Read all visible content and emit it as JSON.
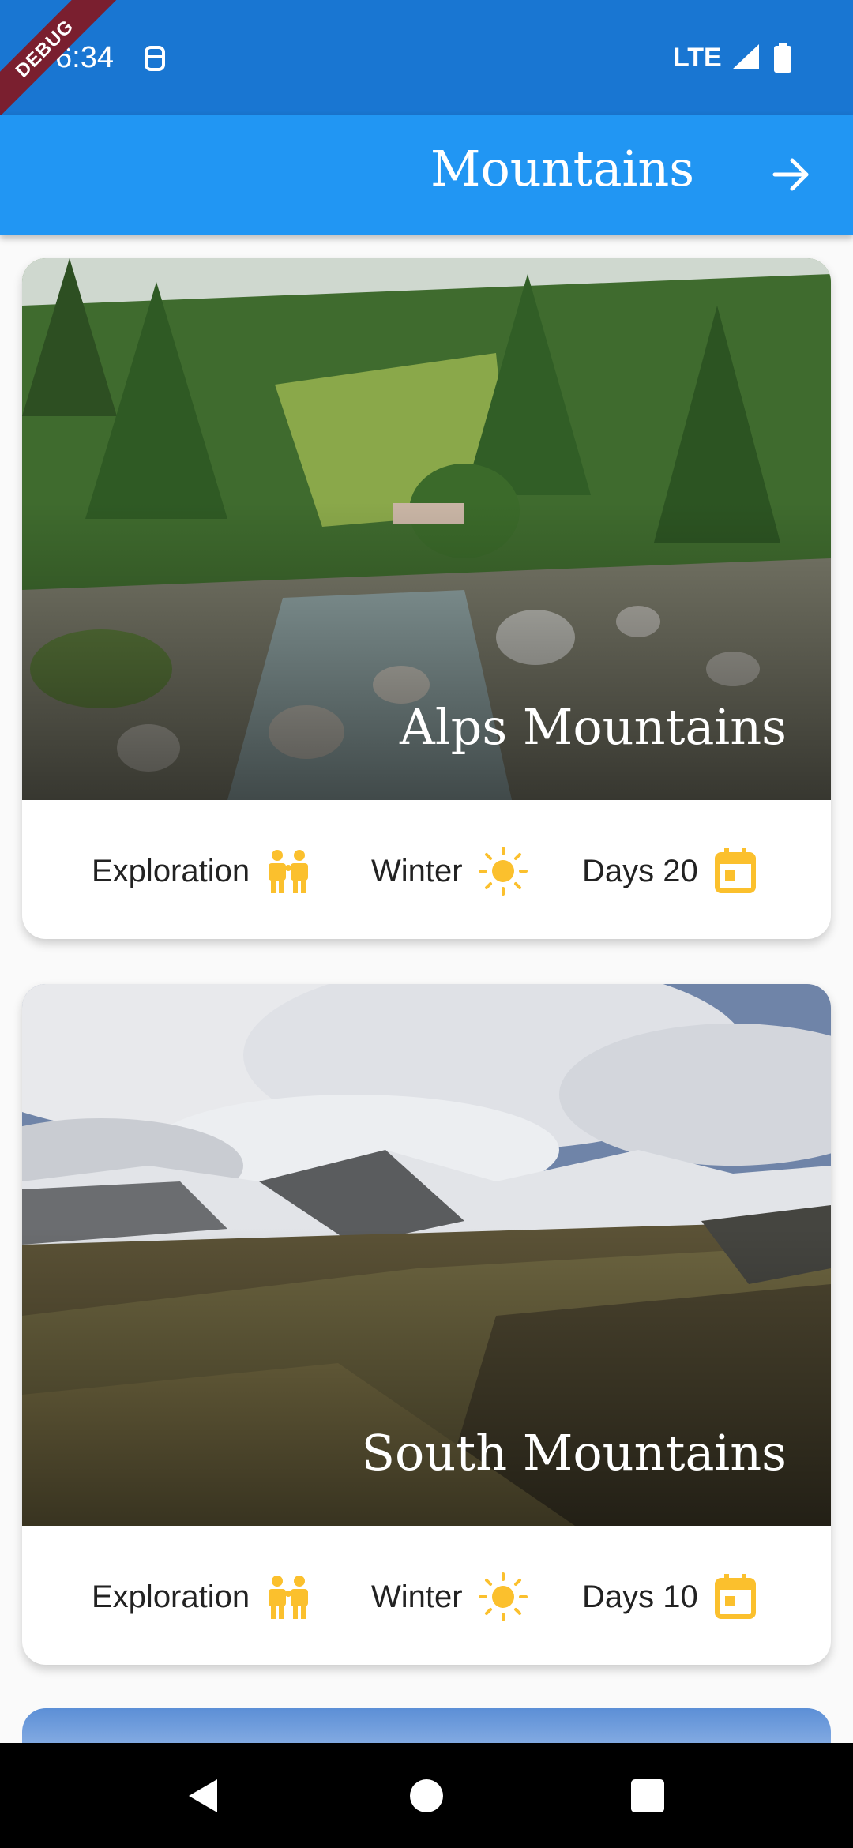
{
  "status_bar": {
    "time": "6:34",
    "network": "LTE",
    "debug_banner": "DEBUG"
  },
  "app_bar": {
    "title": "Mountains",
    "action_icon": "arrow-forward-icon"
  },
  "cards": [
    {
      "title": "Alps Mountains",
      "meta": [
        {
          "label": "Exploration",
          "icon": "people-icon"
        },
        {
          "label": "Winter",
          "icon": "sun-icon"
        },
        {
          "label": "Days 20",
          "icon": "calendar-icon"
        }
      ]
    },
    {
      "title": "South Mountains",
      "meta": [
        {
          "label": "Exploration",
          "icon": "people-icon"
        },
        {
          "label": "Winter",
          "icon": "sun-icon"
        },
        {
          "label": "Days 10",
          "icon": "calendar-icon"
        }
      ]
    }
  ],
  "colors": {
    "status_bar": "#1976d2",
    "app_bar": "#2196f3",
    "icon_accent": "#fbc02d"
  }
}
